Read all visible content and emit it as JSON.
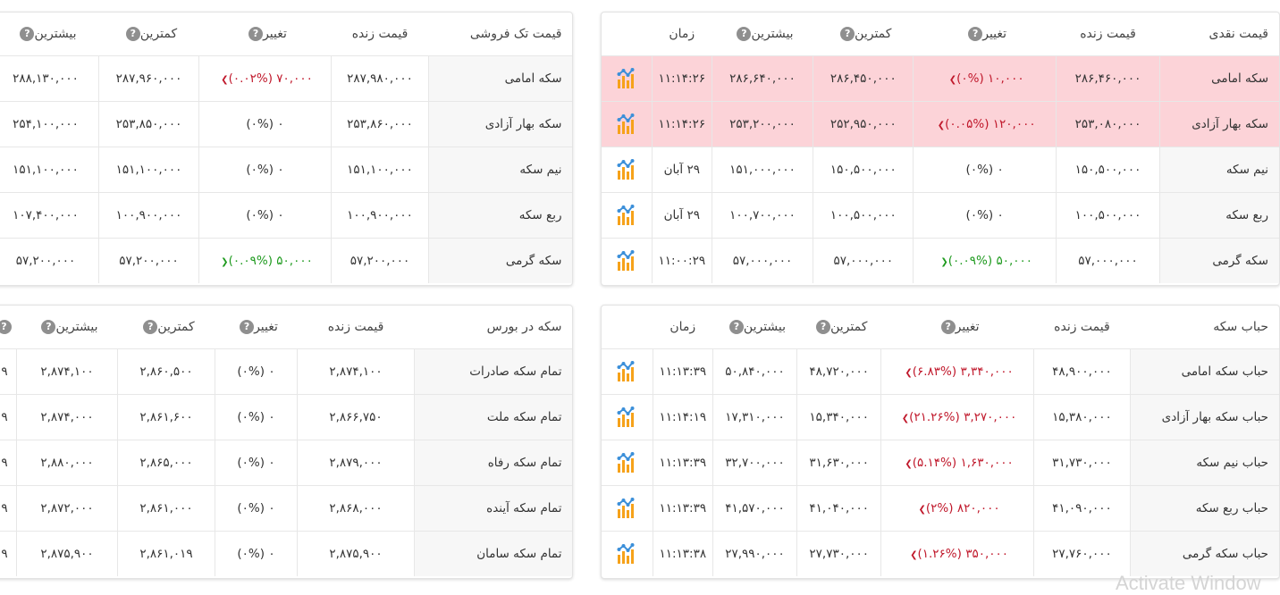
{
  "naghdi": {
    "headers": {
      "name": "قیمت نقدی",
      "live": "قیمت زنده",
      "change": "تغییر",
      "low": "کمترین",
      "high": "بیشترین",
      "time": "زمان"
    },
    "rows": [
      {
        "name": "سکه امامی",
        "live": "۲۸۶,۴۶۰,۰۰۰",
        "change": "۱۰,۰۰۰ (۰%)",
        "dir": "down",
        "low": "۲۸۶,۴۵۰,۰۰۰",
        "high": "۲۸۶,۶۴۰,۰۰۰",
        "time": "۱۱:۱۴:۲۶",
        "highlight": true
      },
      {
        "name": "سکه بهار آزادی",
        "live": "۲۵۳,۰۸۰,۰۰۰",
        "change": "۱۲۰,۰۰۰ (۰.۰۵%)",
        "dir": "down",
        "low": "۲۵۲,۹۵۰,۰۰۰",
        "high": "۲۵۳,۲۰۰,۰۰۰",
        "time": "۱۱:۱۴:۲۶",
        "highlight": true
      },
      {
        "name": "نیم سکه",
        "live": "۱۵۰,۵۰۰,۰۰۰",
        "change": "۰ (۰%)",
        "dir": "none",
        "low": "۱۵۰,۵۰۰,۰۰۰",
        "high": "۱۵۱,۰۰۰,۰۰۰",
        "time": "۲۹ آبان",
        "highlight": false
      },
      {
        "name": "ربع سکه",
        "live": "۱۰۰,۵۰۰,۰۰۰",
        "change": "۰ (۰%)",
        "dir": "none",
        "low": "۱۰۰,۵۰۰,۰۰۰",
        "high": "۱۰۰,۷۰۰,۰۰۰",
        "time": "۲۹ آبان",
        "highlight": false
      },
      {
        "name": "سکه گرمی",
        "live": "۵۷,۰۰۰,۰۰۰",
        "change": "۵۰,۰۰۰ (۰.۰۹%)",
        "dir": "up",
        "low": "۵۷,۰۰۰,۰۰۰",
        "high": "۵۷,۰۰۰,۰۰۰",
        "time": "۱۱:۰۰:۲۹",
        "highlight": false
      }
    ]
  },
  "tak": {
    "headers": {
      "name": "قیمت تک فروشی",
      "live": "قیمت زنده",
      "change": "تغییر",
      "low": "کمترین",
      "high": "بیشترین"
    },
    "rows": [
      {
        "name": "سکه امامی",
        "live": "۲۸۷,۹۸۰,۰۰۰",
        "change": "۷۰,۰۰۰ (۰.۰۲%)",
        "dir": "down",
        "low": "۲۸۷,۹۶۰,۰۰۰",
        "high": "۲۸۸,۱۳۰,۰۰۰"
      },
      {
        "name": "سکه بهار آزادی",
        "live": "۲۵۳,۸۶۰,۰۰۰",
        "change": "۰ (۰%)",
        "dir": "none",
        "low": "۲۵۳,۸۵۰,۰۰۰",
        "high": "۲۵۴,۱۰۰,۰۰۰"
      },
      {
        "name": "نیم سکه",
        "live": "۱۵۱,۱۰۰,۰۰۰",
        "change": "۰ (۰%)",
        "dir": "none",
        "low": "۱۵۱,۱۰۰,۰۰۰",
        "high": "۱۵۱,۱۰۰,۰۰۰"
      },
      {
        "name": "ربع سکه",
        "live": "۱۰۰,۹۰۰,۰۰۰",
        "change": "۰ (۰%)",
        "dir": "none",
        "low": "۱۰۰,۹۰۰,۰۰۰",
        "high": "۱۰۷,۴۰۰,۰۰۰"
      },
      {
        "name": "سکه گرمی",
        "live": "۵۷,۲۰۰,۰۰۰",
        "change": "۵۰,۰۰۰ (۰.۰۹%)",
        "dir": "up",
        "low": "۵۷,۲۰۰,۰۰۰",
        "high": "۵۷,۲۰۰,۰۰۰"
      }
    ]
  },
  "habab": {
    "headers": {
      "name": "حباب سکه",
      "live": "قیمت زنده",
      "change": "تغییر",
      "low": "کمترین",
      "high": "بیشترین",
      "time": "زمان"
    },
    "rows": [
      {
        "name": "حباب سکه امامی",
        "live": "۴۸,۹۰۰,۰۰۰",
        "change": "۳,۳۴۰,۰۰۰ (۶.۸۳%)",
        "dir": "down",
        "low": "۴۸,۷۲۰,۰۰۰",
        "high": "۵۰,۸۴۰,۰۰۰",
        "time": "۱۱:۱۳:۳۹"
      },
      {
        "name": "حباب سکه بهار آزادی",
        "live": "۱۵,۳۸۰,۰۰۰",
        "change": "۳,۲۷۰,۰۰۰ (۲۱.۲۶%)",
        "dir": "down",
        "low": "۱۵,۳۴۰,۰۰۰",
        "high": "۱۷,۳۱۰,۰۰۰",
        "time": "۱۱:۱۴:۱۹"
      },
      {
        "name": "حباب نیم سکه",
        "live": "۳۱,۷۳۰,۰۰۰",
        "change": "۱,۶۳۰,۰۰۰ (۵.۱۴%)",
        "dir": "down",
        "low": "۳۱,۶۳۰,۰۰۰",
        "high": "۳۲,۷۰۰,۰۰۰",
        "time": "۱۱:۱۳:۳۹"
      },
      {
        "name": "حباب ربع سکه",
        "live": "۴۱,۰۹۰,۰۰۰",
        "change": "۸۲۰,۰۰۰ (۲%)",
        "dir": "down",
        "low": "۴۱,۰۴۰,۰۰۰",
        "high": "۴۱,۵۷۰,۰۰۰",
        "time": "۱۱:۱۳:۳۹"
      },
      {
        "name": "حباب سکه گرمی",
        "live": "۲۷,۷۶۰,۰۰۰",
        "change": "۳۵۰,۰۰۰ (۱.۲۶%)",
        "dir": "down",
        "low": "۲۷,۷۳۰,۰۰۰",
        "high": "۲۷,۹۹۰,۰۰۰",
        "time": "۱۱:۱۳:۳۸"
      }
    ]
  },
  "bourse": {
    "headers": {
      "name": "سکه در بورس",
      "live": "قیمت زنده",
      "change": "تغییر",
      "low": "کمترین",
      "high": "بیشترین"
    },
    "rows": [
      {
        "name": "تمام سکه صادرات",
        "live": "۲,۸۷۴,۱۰۰",
        "change": "۰ (۰%)",
        "dir": "none",
        "low": "۲,۸۶۰,۵۰۰",
        "high": "۲,۸۷۴,۱۰۰",
        "extra": "۹"
      },
      {
        "name": "تمام سکه ملت",
        "live": "۲,۸۶۶,۷۵۰",
        "change": "۰ (۰%)",
        "dir": "none",
        "low": "۲,۸۶۱,۶۰۰",
        "high": "۲,۸۷۴,۰۰۰",
        "extra": "۹"
      },
      {
        "name": "تمام سکه رفاه",
        "live": "۲,۸۷۹,۰۰۰",
        "change": "۰ (۰%)",
        "dir": "none",
        "low": "۲,۸۶۵,۰۰۰",
        "high": "۲,۸۸۰,۰۰۰",
        "extra": "۹"
      },
      {
        "name": "تمام سکه آینده",
        "live": "۲,۸۶۸,۰۰۰",
        "change": "۰ (۰%)",
        "dir": "none",
        "low": "۲,۸۶۱,۰۰۰",
        "high": "۲,۸۷۲,۰۰۰",
        "extra": "۹"
      },
      {
        "name": "تمام سکه سامان",
        "live": "۲,۸۷۵,۹۰۰",
        "change": "۰ (۰%)",
        "dir": "none",
        "low": "۲,۸۶۱,۰۱۹",
        "high": "۲,۸۷۵,۹۰۰",
        "extra": "۹"
      }
    ]
  },
  "help_glyph": "?",
  "watermark": "Activate Window",
  "colors": {
    "negative": "#c0182b",
    "positive": "#1e9a1e",
    "highlight_row": "#fcd3d8",
    "help_icon": "#8f8f8f"
  }
}
